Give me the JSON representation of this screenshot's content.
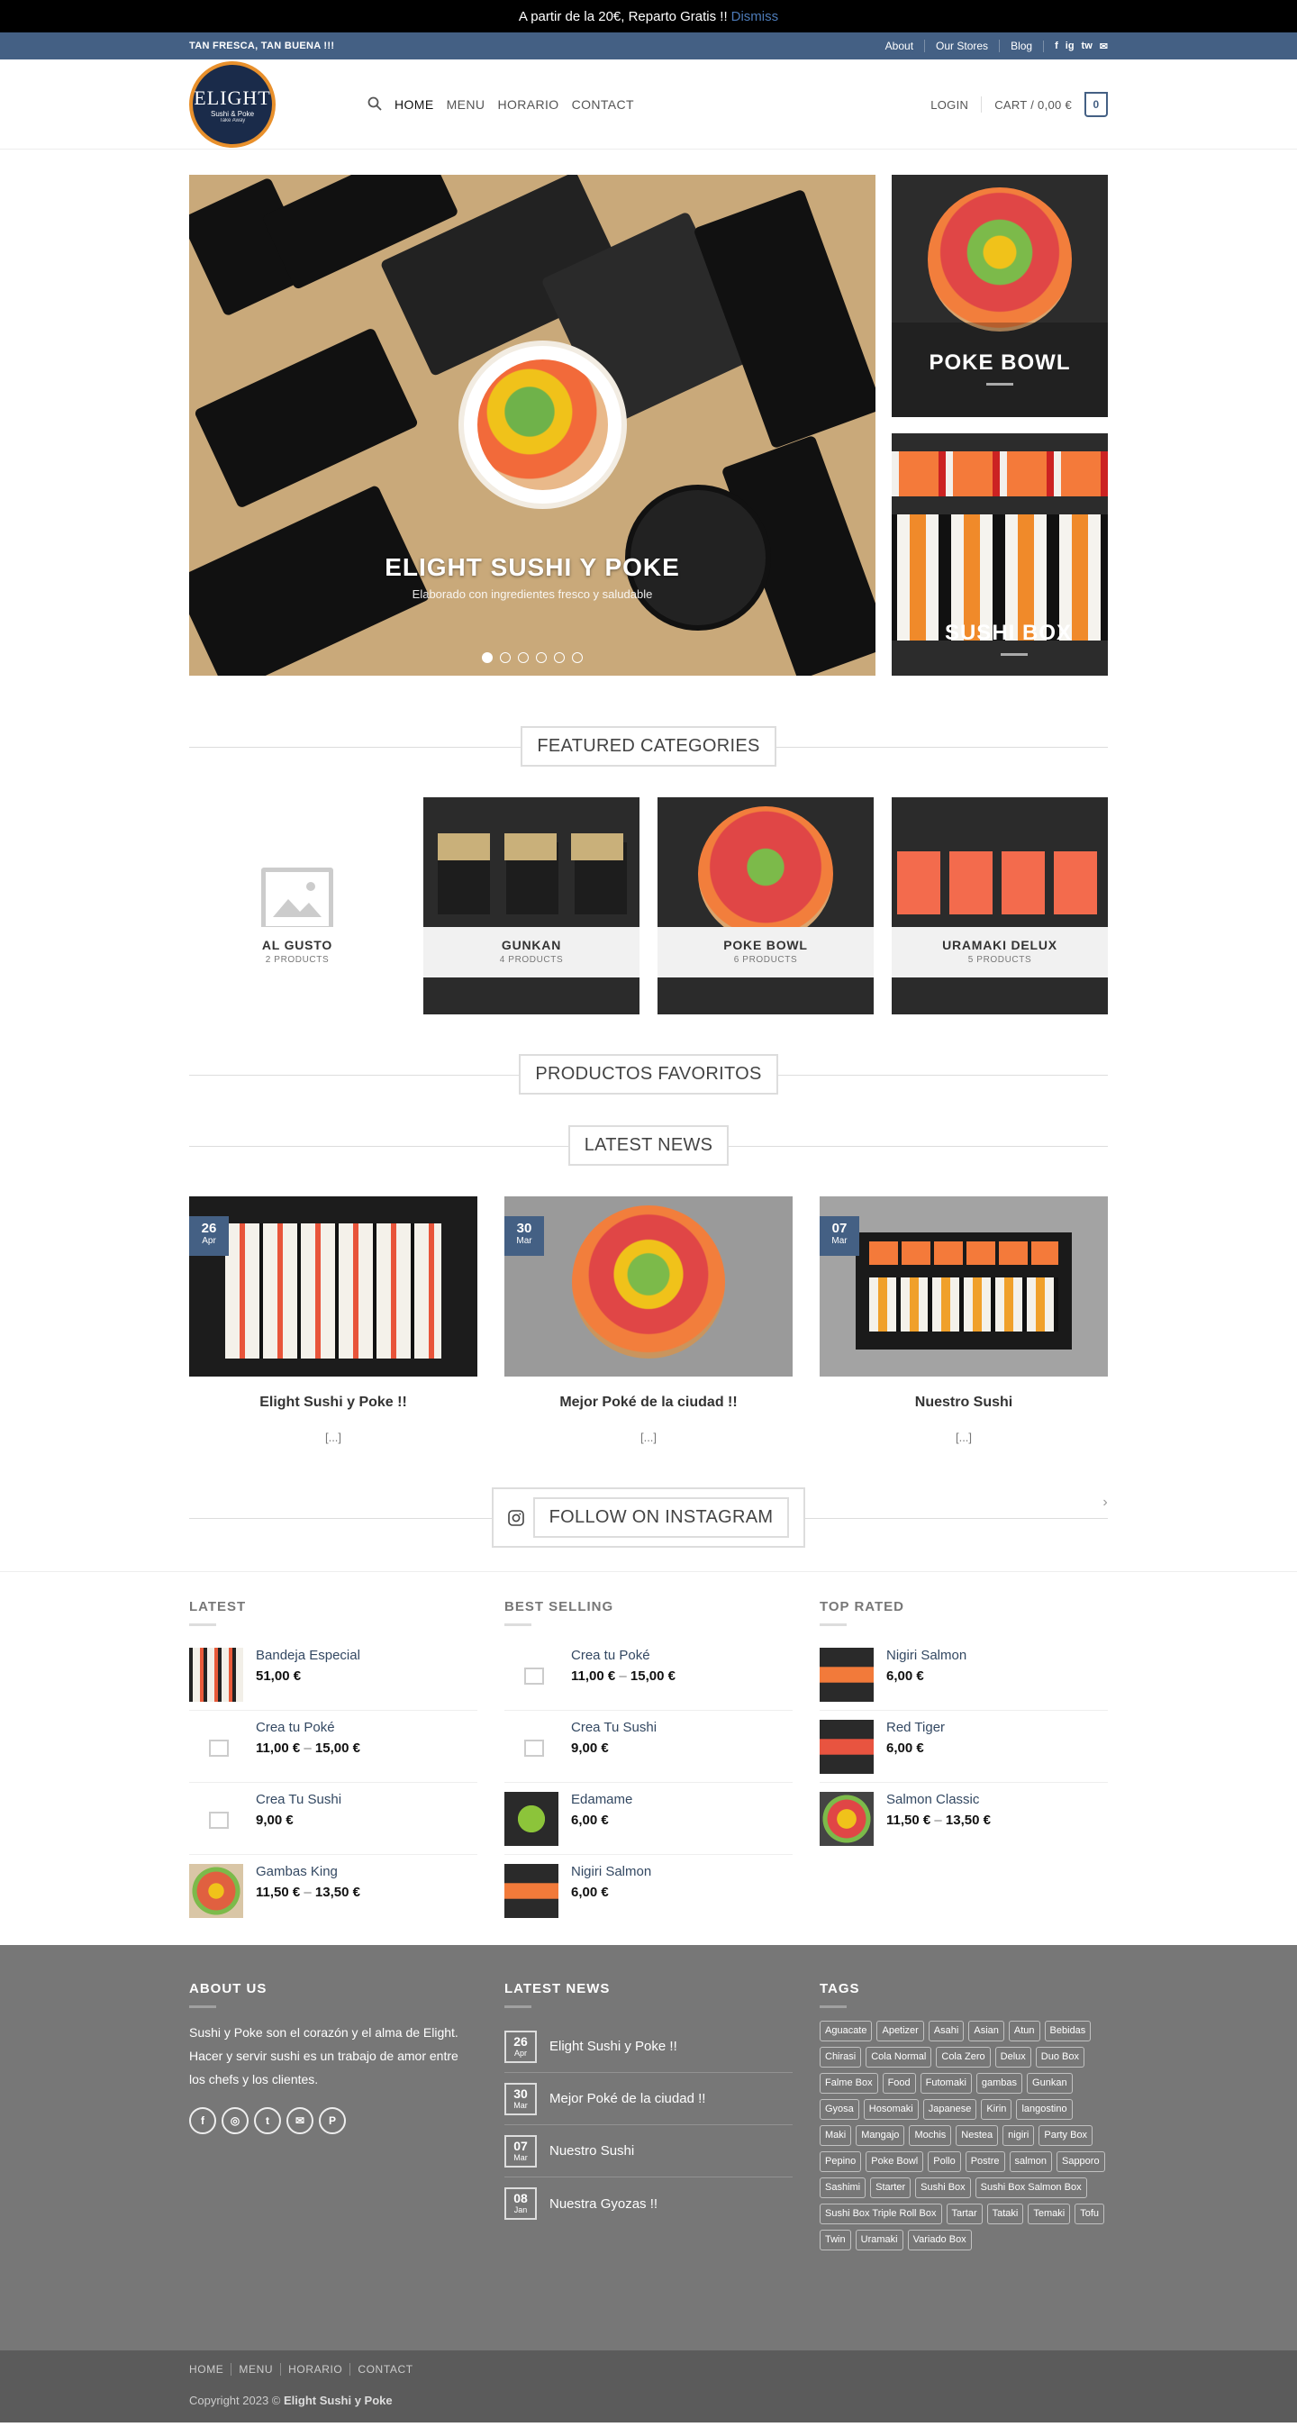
{
  "notice": {
    "text": "A partir de la 20€, Reparto Gratis !!",
    "dismiss": "Dismiss"
  },
  "topbar": {
    "tagline": "TAN FRESCA, TAN BUENA !!!",
    "links": [
      "About",
      "Our Stores",
      "Blog"
    ],
    "social": [
      "f",
      "ig",
      "tw",
      "✉"
    ]
  },
  "logo": {
    "line1": "ELIGHT",
    "line2": "Sushi & Poke",
    "line3": "Take Away"
  },
  "nav": {
    "items": [
      "HOME",
      "MENU",
      "HORARIO",
      "CONTACT"
    ],
    "login": "LOGIN",
    "cart": "CART / 0,00 €",
    "cart_count": "0"
  },
  "hero": {
    "title": "ELIGHT SUSHI Y POKE",
    "subtitle": "Elaborado con ingredientes fresco y saludable",
    "side": [
      "POKE BOWL",
      "SUSHI BOX"
    ]
  },
  "categories": {
    "title": "FEATURED CATEGORIES",
    "items": [
      {
        "name": "AL GUSTO",
        "count": "2 PRODUCTS"
      },
      {
        "name": "GUNKAN",
        "count": "4 PRODUCTS"
      },
      {
        "name": "POKE BOWL",
        "count": "6 PRODUCTS"
      },
      {
        "name": "URAMAKI DELUX",
        "count": "5 PRODUCTS"
      }
    ]
  },
  "favorites": {
    "title": "PRODUCTOS FAVORITOS"
  },
  "news": {
    "title": "LATEST NEWS",
    "posts": [
      {
        "day": "26",
        "month": "Apr",
        "title": "Elight Sushi y Poke !!",
        "excerpt": "[...]"
      },
      {
        "day": "30",
        "month": "Mar",
        "title": "Mejor Poké de la ciudad !!",
        "excerpt": "[...]"
      },
      {
        "day": "07",
        "month": "Mar",
        "title": "Nuestro Sushi",
        "excerpt": "[...]"
      }
    ]
  },
  "instagram": {
    "title": "FOLLOW ON INSTAGRAM",
    "arrow": "›"
  },
  "lists": [
    {
      "title": "LATEST",
      "items": [
        {
          "name": "Bandeja Especial",
          "price": "51,00 €",
          "price2": ""
        },
        {
          "name": "Crea tu Poké",
          "price": "11,00 €",
          "price2": "15,00 €"
        },
        {
          "name": "Crea Tu Sushi",
          "price": "9,00 €",
          "price2": ""
        },
        {
          "name": "Gambas King",
          "price": "11,50 €",
          "price2": "13,50 €"
        }
      ]
    },
    {
      "title": "BEST SELLING",
      "items": [
        {
          "name": "Crea tu Poké",
          "price": "11,00 €",
          "price2": "15,00 €"
        },
        {
          "name": "Crea Tu Sushi",
          "price": "9,00 €",
          "price2": ""
        },
        {
          "name": "Edamame",
          "price": "6,00 €",
          "price2": ""
        },
        {
          "name": "Nigiri Salmon",
          "price": "6,00 €",
          "price2": ""
        }
      ]
    },
    {
      "title": "TOP RATED",
      "items": [
        {
          "name": "Nigiri Salmon",
          "price": "6,00 €",
          "price2": ""
        },
        {
          "name": "Red Tiger",
          "price": "6,00 €",
          "price2": ""
        },
        {
          "name": "Salmon Classic",
          "price": "11,50 €",
          "price2": "13,50 €"
        }
      ]
    }
  ],
  "footer": {
    "about_title": "ABOUT US",
    "about_text": "Sushi y Poke son el corazón y el alma de Elight. Hacer y servir sushi es un trabajo de amor entre los chefs y los clientes.",
    "news_title": "LATEST NEWS",
    "news": [
      {
        "day": "26",
        "month": "Apr",
        "title": "Elight Sushi y Poke !!"
      },
      {
        "day": "30",
        "month": "Mar",
        "title": "Mejor Poké de la ciudad !!"
      },
      {
        "day": "07",
        "month": "Mar",
        "title": "Nuestro Sushi"
      },
      {
        "day": "08",
        "month": "Jan",
        "title": "Nuestra Gyozas !!"
      }
    ],
    "tags_title": "TAGS",
    "tags": [
      "Aguacate",
      "Apetizer",
      "Asahi",
      "Asian",
      "Atun",
      "Bebidas",
      "Chirasi",
      "Cola Normal",
      "Cola Zero",
      "Delux",
      "Duo Box",
      "Falme Box",
      "Food",
      "Futomaki",
      "gambas",
      "Gunkan",
      "Gyosa",
      "Hosomaki",
      "Japanese",
      "Kirin",
      "langostino",
      "Maki",
      "Mangajo",
      "Mochis",
      "Nestea",
      "nigiri",
      "Party Box",
      "Pepino",
      "Poke Bowl",
      "Pollo",
      "Postre",
      "salmon",
      "Sapporo",
      "Sashimi",
      "Starter",
      "Sushi Box",
      "Sushi Box Salmon Box",
      "Sushi Box Triple Roll Box",
      "Tartar",
      "Tataki",
      "Temaki",
      "Tofu",
      "Twin",
      "Uramaki",
      "Variado Box"
    ],
    "bottom_nav": [
      "HOME",
      "MENU",
      "HORARIO",
      "CONTACT"
    ],
    "copyright_prefix": "Copyright 2023 ©",
    "copyright_name": "Elight Sushi y Poke"
  },
  "colors": {
    "primary": "#446084",
    "link": "#334862",
    "footer": "#777777",
    "absolute_footer": "#5b5b5b"
  }
}
